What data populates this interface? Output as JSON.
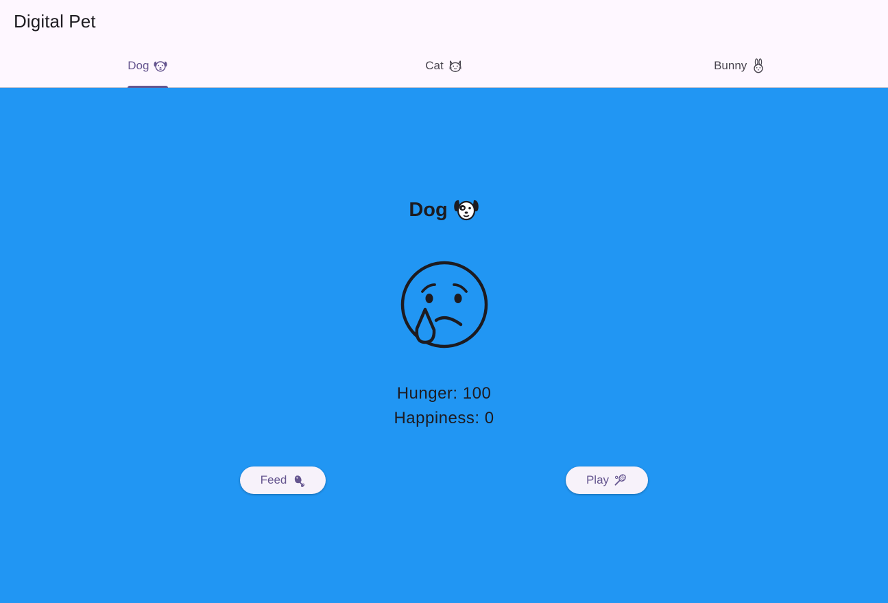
{
  "app": {
    "title": "Digital Pet"
  },
  "tabs": [
    {
      "label": "Dog",
      "icon": "dog-face-icon",
      "active": true
    },
    {
      "label": "Cat",
      "icon": "cat-face-icon",
      "active": false
    },
    {
      "label": "Bunny",
      "icon": "rabbit-face-icon",
      "active": false
    }
  ],
  "pet": {
    "name": "Dog",
    "name_icon": "dog-face-icon",
    "mood_icon": "crying-face-icon",
    "hunger_text": "Hunger: 100",
    "happiness_text": "Happiness: 0"
  },
  "actions": {
    "feed_label": "Feed",
    "feed_icon": "meat-on-bone-icon",
    "play_label": "Play",
    "play_icon": "tennis-racket-icon"
  },
  "colors": {
    "background": "#2196F3",
    "appbar": "#FEF7FF",
    "accent": "#65558F",
    "button_bg": "#F7F2FA",
    "text": "#1D1B20"
  }
}
